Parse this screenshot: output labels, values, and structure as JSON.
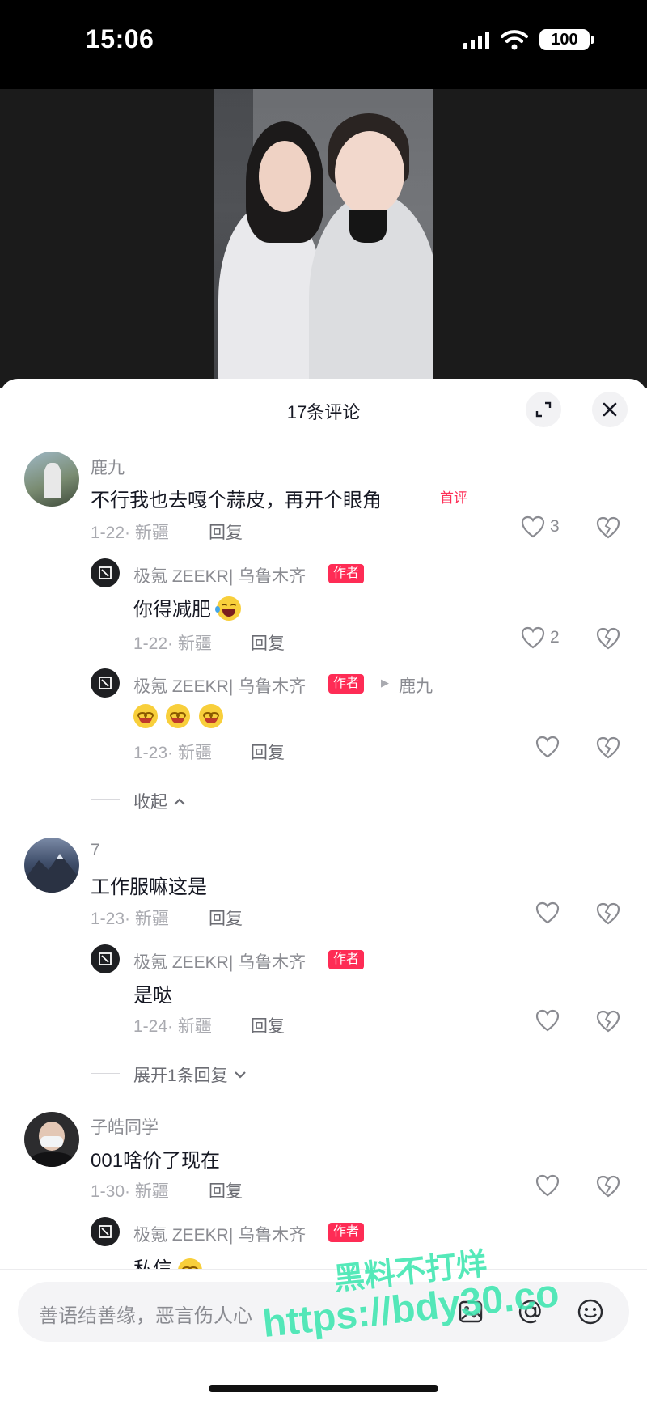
{
  "status_bar": {
    "time": "15:06",
    "battery": "100"
  },
  "sheet": {
    "title": "17条评论"
  },
  "comments": [
    {
      "username": "鹿九",
      "text": "不行我也去嘎个蒜皮，再开个眼角",
      "badge": "首评",
      "date_location": "1-22· 新疆",
      "reply_label": "回复",
      "likes": "3",
      "replies": [
        {
          "username": "极氪 ZEEKR| 乌鲁木齐",
          "tag": "作者",
          "text": "你得减肥",
          "date_location": "1-22· 新疆",
          "reply_label": "回复",
          "likes": "2"
        },
        {
          "username": "极氪 ZEEKR| 乌鲁木齐",
          "tag": "作者",
          "reply_to": "鹿九",
          "date_location": "1-23· 新疆",
          "reply_label": "回复",
          "likes": ""
        }
      ],
      "toggle": "收起"
    },
    {
      "username": "7",
      "text": "工作服嘛这是",
      "date_location": "1-23· 新疆",
      "reply_label": "回复",
      "likes": "",
      "replies": [
        {
          "username": "极氪 ZEEKR| 乌鲁木齐",
          "tag": "作者",
          "text": "是哒",
          "date_location": "1-24· 新疆",
          "reply_label": "回复",
          "likes": ""
        }
      ],
      "toggle": "展开1条回复"
    },
    {
      "username": "子皓同学",
      "text": "001啥价了现在",
      "date_location": "1-30· 新疆",
      "reply_label": "回复",
      "likes": "",
      "replies": [
        {
          "username": "极氪 ZEEKR| 乌鲁木齐",
          "tag": "作者",
          "text": "私信"
        }
      ]
    }
  ],
  "input": {
    "placeholder": "善语结善缘，恶言伤人心"
  },
  "watermark": {
    "line1": "黑料不打烊",
    "line2": "https://bdy30.co"
  },
  "colors": {
    "accent": "#fe2c55",
    "watermark": "#3ee6b0"
  }
}
